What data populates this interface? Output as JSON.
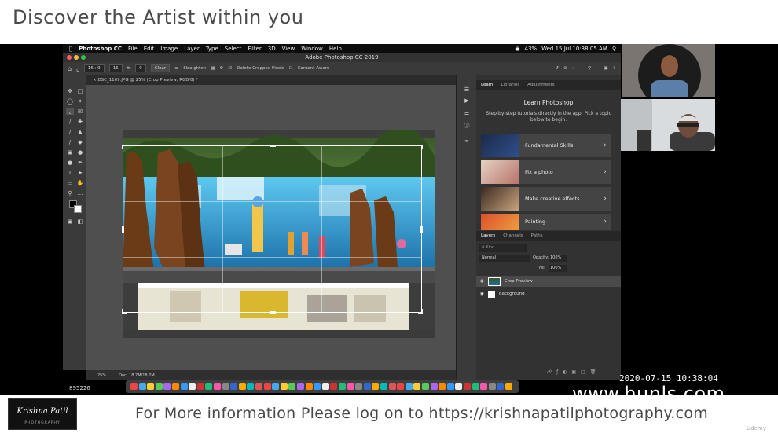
{
  "banner": {
    "title": "Discover the Artist within you"
  },
  "mac_menubar": {
    "items": [
      "Photoshop CC",
      "File",
      "Edit",
      "Image",
      "Layer",
      "Type",
      "Select",
      "Filter",
      "3D",
      "View",
      "Window",
      "Help"
    ],
    "battery": "43%",
    "clock": "Wed 15 Jul  10:38:05 AM"
  },
  "window": {
    "title": "Adobe Photoshop CC 2019"
  },
  "options_bar": {
    "ratio": "16 : 9",
    "width": "16",
    "height": "9",
    "clear_label": "Clear",
    "straighten_label": "Straighten",
    "delete_cropped_label": "Delete Cropped Pixels",
    "content_aware_label": "Content-Aware"
  },
  "document": {
    "tab_label": "DSC_1109.JPG @ 25% (Crop Preview, RGB/8) *"
  },
  "status_bar": {
    "zoom": "25%",
    "doc_size": "Doc: 18.7M/18.7M"
  },
  "panels": {
    "learn_tabs": [
      "Learn",
      "Libraries",
      "Adjustments"
    ],
    "learn_heading": "Learn Photoshop",
    "learn_description": "Step-by-step tutorials directly in the app. Pick a topic below to begin.",
    "learn_cards": [
      "Fundamental Skills",
      "Fix a photo",
      "Make creative effects",
      "Painting"
    ],
    "layer_tabs": [
      "Layers",
      "Channels",
      "Paths"
    ],
    "blend_mode": "Normal",
    "opacity_label": "Opacity:",
    "opacity_value": "100%",
    "fill_label": "Fill:",
    "fill_value": "100%",
    "kind_placeholder": "Kind",
    "layers": [
      "Crop Preview",
      "Background"
    ]
  },
  "overlay": {
    "datetime": "2020-07-15  10:38:04",
    "watermark": "www.hunls.com",
    "dock_badge": "895226"
  },
  "footer": {
    "logo_text": "Krishna Patil",
    "logo_sub": "PHOTOGRAPHY",
    "info": "For More information Please log on to https://krishnapatilphotography.com",
    "udemy": "Udemy"
  },
  "colors": {
    "accent_blue": "#2d8ceb",
    "ps_dark": "#323232",
    "ps_panel": "#3a3a3a"
  }
}
